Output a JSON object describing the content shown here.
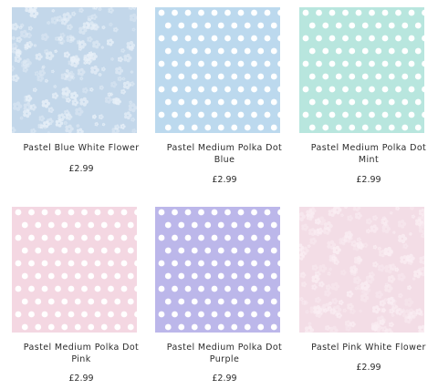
{
  "products": [
    {
      "name_line1": "Pastel Blue White Flower",
      "name_line2": "",
      "price": "£2.99",
      "pattern": "flower",
      "color": "#c3d7ea",
      "pattern_color": "#e9f1f9"
    },
    {
      "name_line1": "Pastel Medium Polka Dot",
      "name_line2": "Blue",
      "price": "£2.99",
      "pattern": "polka-dot",
      "color": "#bcd9ee",
      "pattern_color": "#ffffff"
    },
    {
      "name_line1": "Pastel Medium Polka Dot",
      "name_line2": "Mint",
      "price": "£2.99",
      "pattern": "polka-dot",
      "color": "#b8e6de",
      "pattern_color": "#ffffff"
    },
    {
      "name_line1": "Pastel Medium Polka Dot",
      "name_line2": "Pink",
      "price": "£2.99",
      "pattern": "polka-dot",
      "color": "#f4d7e2",
      "pattern_color": "#ffffff"
    },
    {
      "name_line1": "Pastel Medium Polka Dot",
      "name_line2": "Purple",
      "price": "£2.99",
      "pattern": "polka-dot",
      "color": "#bcb7ea",
      "pattern_color": "#ffffff"
    },
    {
      "name_line1": "Pastel Pink White Flower",
      "name_line2": "",
      "price": "£2.99",
      "pattern": "flower",
      "color": "#f3dde6",
      "pattern_color": "#fbeff4"
    }
  ]
}
